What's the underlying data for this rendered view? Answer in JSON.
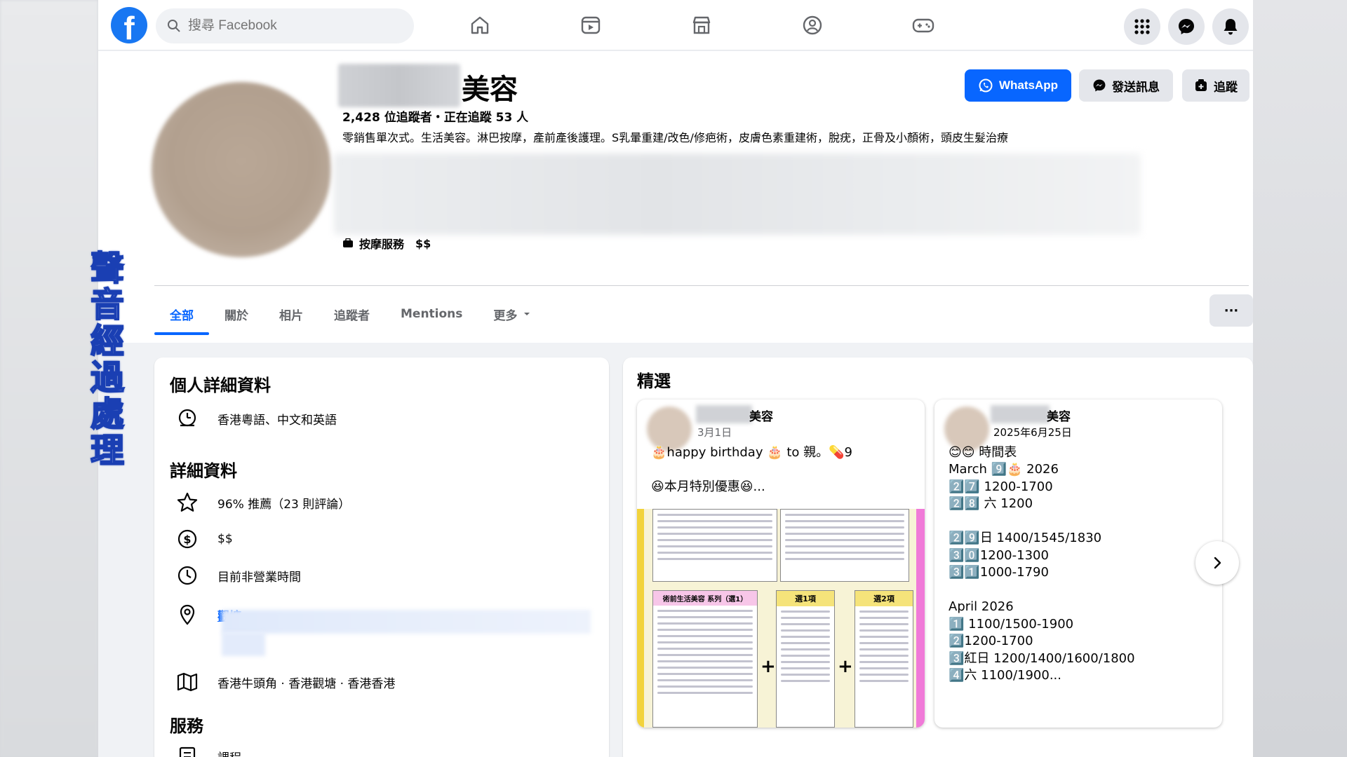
{
  "watermark": [
    "聲",
    "音",
    "經",
    "過",
    "處",
    "理"
  ],
  "topbar": {
    "logo": "f",
    "search_placeholder": "搜尋 Facebook"
  },
  "profile": {
    "name_suffix": "美容",
    "stats": "2,428 位追蹤者・正在追蹤 53 人",
    "bio": "零銷售單次式。生活美容。淋巴按摩，產前產後護理。S乳暈重建/改色/修疤術，皮膚色素重建術，脫疣，正骨及小顏術，頭皮生髮治療",
    "category": "按摩服務",
    "price": "$$",
    "buttons": {
      "whatsapp": "WhatsApp",
      "message": "發送訊息",
      "follow": "追蹤"
    },
    "colors": {
      "accent": "#0866ff",
      "facebook_blue": "#1877f2"
    }
  },
  "tabs": [
    {
      "label": "全部",
      "active": true
    },
    {
      "label": "關於",
      "active": false
    },
    {
      "label": "相片",
      "active": false
    },
    {
      "label": "追蹤者",
      "active": false
    },
    {
      "label": "Mentions",
      "active": false
    },
    {
      "label": "更多",
      "active": false
    }
  ],
  "more_menu": "···",
  "info": {
    "personal_title": "個人詳細資料",
    "languages": "香港粵語、中文和英語",
    "details_title": "詳細資料",
    "rating": "96% 推薦（23 則評論）",
    "price": "$$",
    "hours": "目前非營業時間",
    "address_visible": "觀塘",
    "areas": "香港牛頭角 · 香港觀塘 · 香港香港",
    "services_title": "服務",
    "service_item": "課程"
  },
  "featured": {
    "title": "精選",
    "posts": [
      {
        "name_suffix": "美容",
        "date": "3月1日",
        "lines": [
          "🎂happy birthday 🎂 to 親。💊9",
          "",
          "😆本月特別優惠😆..."
        ],
        "menu_headers": [
          "術前生活美容 系列（選1）",
          "選1項",
          "選2項"
        ]
      },
      {
        "name_suffix": "美容",
        "date": "2025年6月25日",
        "lines": [
          "😊😊 時間表",
          "March 9️⃣🎂 2026",
          "2️⃣7️⃣ 1200-1700",
          "2️⃣8️⃣ 六 1200",
          "",
          "2️⃣9️⃣日 1400/1545/1830",
          "3️⃣0️⃣1200-1300",
          "3️⃣1️⃣1000-1790",
          "",
          "April 2026",
          "1️⃣ 1100/1500-1900",
          "2️⃣1200-1700",
          "3️⃣紅日 1200/1400/1600/1800",
          "4️⃣六 1100/1900..."
        ]
      }
    ]
  }
}
